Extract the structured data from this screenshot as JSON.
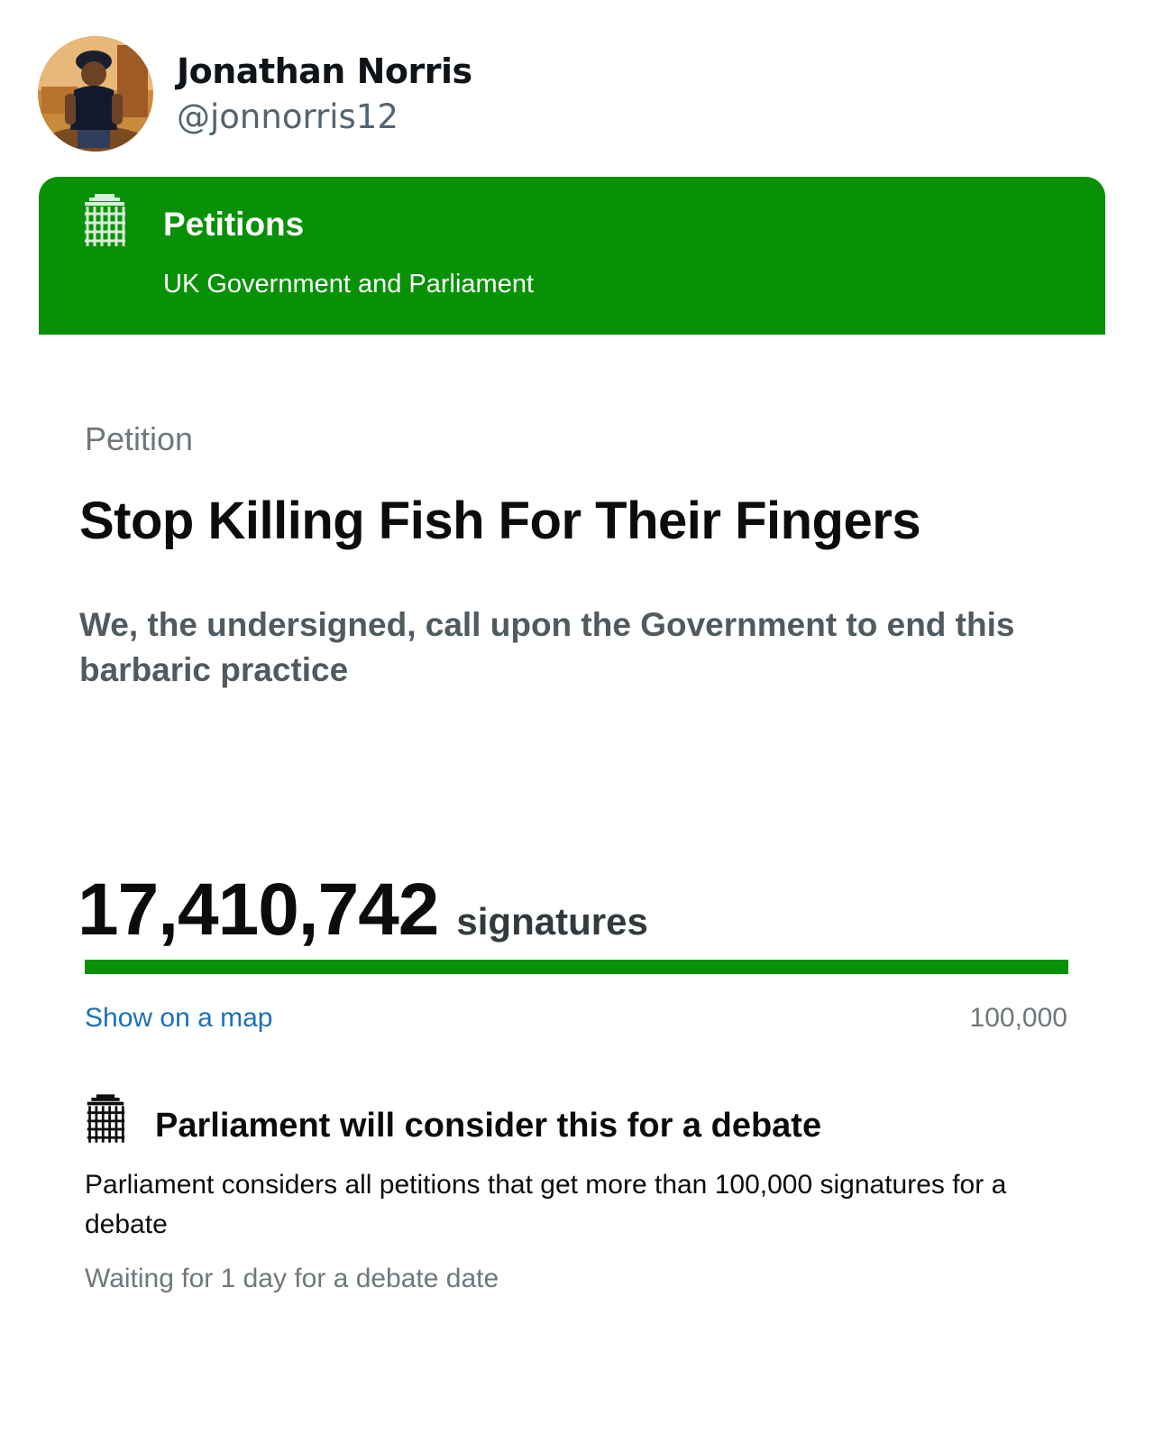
{
  "tweet": {
    "author_name": "Jonathan Norris",
    "author_handle": "@jonnorris12"
  },
  "banner": {
    "title": "Petitions",
    "subtitle": "UK Government and Parliament",
    "logo_icon": "portcullis-icon",
    "background_color": "#089106"
  },
  "petition": {
    "label": "Petition",
    "title": "Stop Killing Fish For Their Fingers",
    "action": "We, the undersigned, call upon the Government to end this barbaric practice"
  },
  "signatures": {
    "count": "17,410,742",
    "unit": "signatures",
    "progress_fraction": 1.0,
    "map_link": "Show on a map",
    "threshold": "100,000"
  },
  "debate": {
    "heading": "Parliament will consider this for a debate",
    "description": "Parliament considers all petitions that get more than 100,000 signatures for a debate",
    "waiting": "Waiting for 1 day for a debate date",
    "icon": "portcullis-icon"
  },
  "colors": {
    "accent_green": "#089106",
    "link_blue": "#1d70b8",
    "secondary_text": "#6f777b"
  }
}
